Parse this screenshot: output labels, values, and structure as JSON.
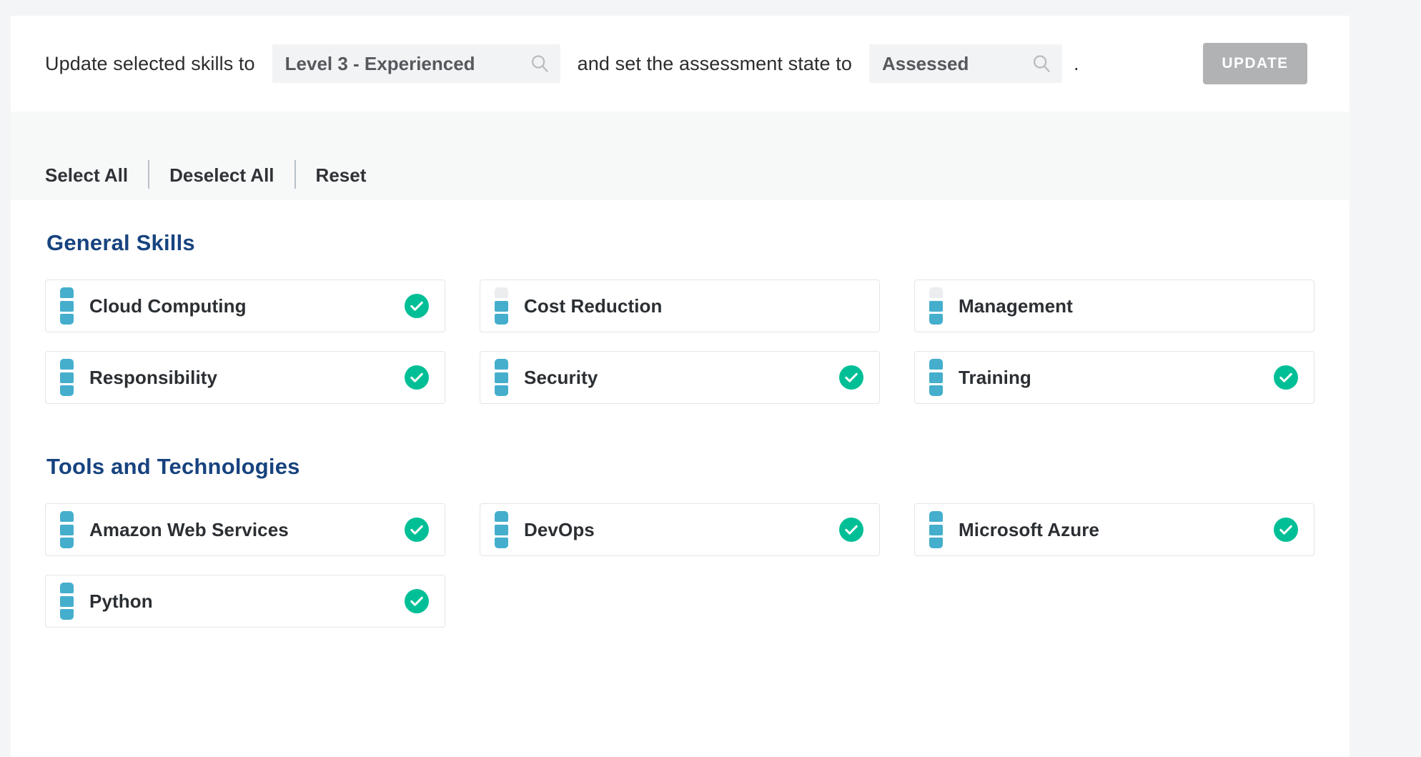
{
  "colors": {
    "page_background": "#f4f5f6",
    "panel_background": "#ffffff",
    "section_heading": "#17437f",
    "level_filled": "#45aecd",
    "level_empty": "#ebedef",
    "check_green": "#00bf96",
    "update_button": "#b0b2b4",
    "picker_background": "#f2f3f4"
  },
  "bulk_update": {
    "lead_text": "Update selected skills to",
    "mid_text": "and set the assessment state to",
    "trailing_punctuation": ".",
    "level_picker": {
      "value": "Level 3 - Experienced",
      "placeholder": "Level 3 - Experienced",
      "icon": "search-icon"
    },
    "state_picker": {
      "value": "Assessed",
      "placeholder": "Assessed",
      "icon": "search-icon"
    },
    "update_button_label": "UPDATE"
  },
  "selection_toolbar": {
    "links": [
      {
        "label": "Select All"
      },
      {
        "label": "Deselect All"
      },
      {
        "label": "Reset"
      }
    ]
  },
  "sections": [
    {
      "title": "General Skills",
      "skills": [
        {
          "name": "Cloud Computing",
          "level": 3,
          "max_level": 3,
          "assessed": true
        },
        {
          "name": "Cost Reduction",
          "level": 2,
          "max_level": 3,
          "assessed": false
        },
        {
          "name": "Management",
          "level": 2,
          "max_level": 3,
          "assessed": false
        },
        {
          "name": "Responsibility",
          "level": 3,
          "max_level": 3,
          "assessed": true
        },
        {
          "name": "Security",
          "level": 3,
          "max_level": 3,
          "assessed": true
        },
        {
          "name": "Training",
          "level": 3,
          "max_level": 3,
          "assessed": true
        }
      ]
    },
    {
      "title": "Tools and Technologies",
      "skills": [
        {
          "name": "Amazon Web Services",
          "level": 3,
          "max_level": 3,
          "assessed": true
        },
        {
          "name": "DevOps",
          "level": 3,
          "max_level": 3,
          "assessed": true
        },
        {
          "name": "Microsoft Azure",
          "level": 3,
          "max_level": 3,
          "assessed": true
        },
        {
          "name": "Python",
          "level": 3,
          "max_level": 3,
          "assessed": true
        }
      ]
    }
  ]
}
